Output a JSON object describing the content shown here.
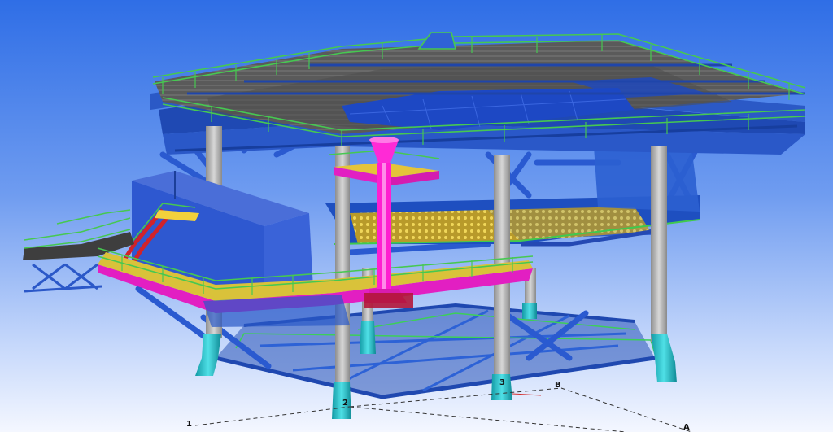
{
  "viewport": {
    "background_top": "#2f6ee6",
    "background_bottom": "#f4f7ff"
  },
  "colors": {
    "steel_blue": "#2f5fc8",
    "steel_dark": "#1d3f99",
    "handrail_green": "#42c24a",
    "walkway_yellow": "#e4c43a",
    "pipe_magenta": "#ff1fd0",
    "leg_grey": "#b3b3b3",
    "leg_cyan": "#25c6cf",
    "deck_grey": "#5b5b5b",
    "module_blue": "#2f5bd4"
  },
  "grid_labels": {
    "axis_1": "1",
    "axis_2": "2",
    "axis_3": "3",
    "axis_A": "A",
    "axis_B": "B"
  }
}
